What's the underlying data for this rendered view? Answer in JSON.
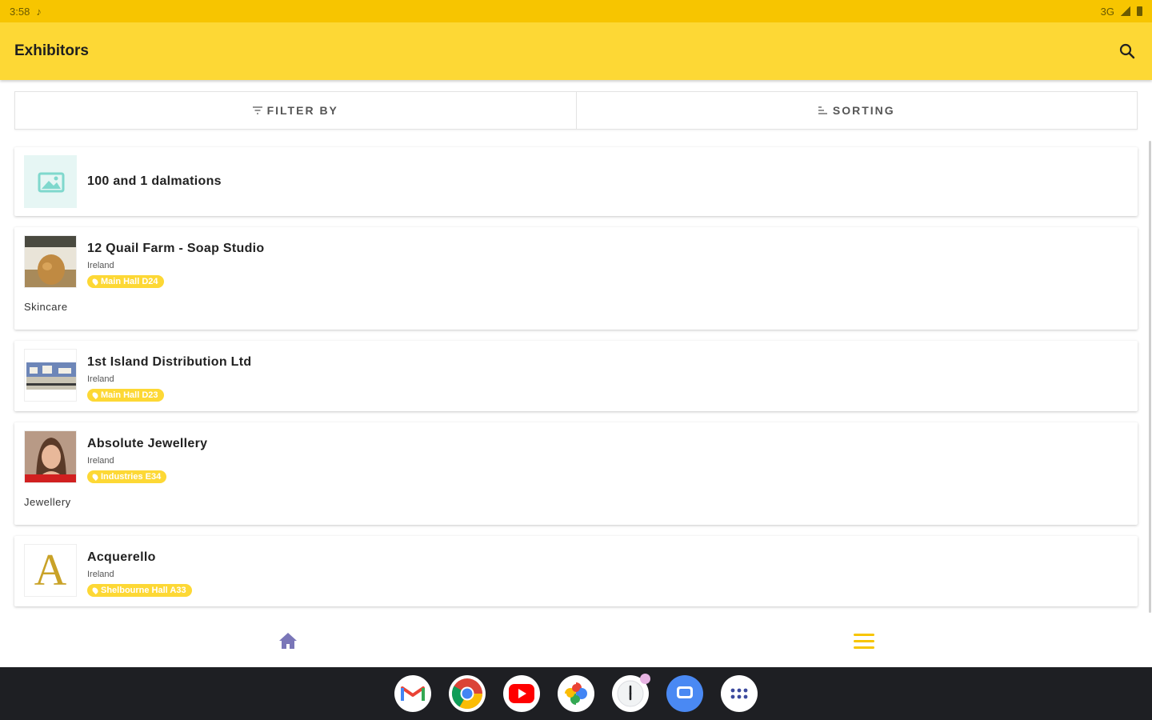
{
  "status_bar": {
    "time": "3:58",
    "network": "3G"
  },
  "app_bar": {
    "title": "Exhibitors"
  },
  "toolbar": {
    "filter_label": "FILTER BY",
    "sorting_label": "SORTING"
  },
  "exhibitors": [
    {
      "name": "100 and 1 dalmations",
      "country": "",
      "location": "",
      "category": ""
    },
    {
      "name": "12 Quail Farm - Soap Studio",
      "country": "Ireland",
      "location": "Main Hall D24",
      "category": "Skincare"
    },
    {
      "name": "1st Island Distribution Ltd",
      "country": "Ireland",
      "location": "Main Hall D23",
      "category": ""
    },
    {
      "name": "Absolute Jewellery",
      "country": "Ireland",
      "location": "Industries E34",
      "category": "Jewellery"
    },
    {
      "name": "Acquerello",
      "country": "Ireland",
      "location": "Shelbourne Hall A33",
      "category": ""
    }
  ],
  "thumb_letter": "A",
  "colors": {
    "accent": "#fdd835",
    "status": "#f7c500",
    "nav_home": "#7a76b8"
  },
  "taskbar_apps": [
    "gmail-icon",
    "chrome-icon",
    "youtube-icon",
    "photos-icon",
    "clock-icon",
    "messages-icon",
    "app-drawer-icon"
  ]
}
